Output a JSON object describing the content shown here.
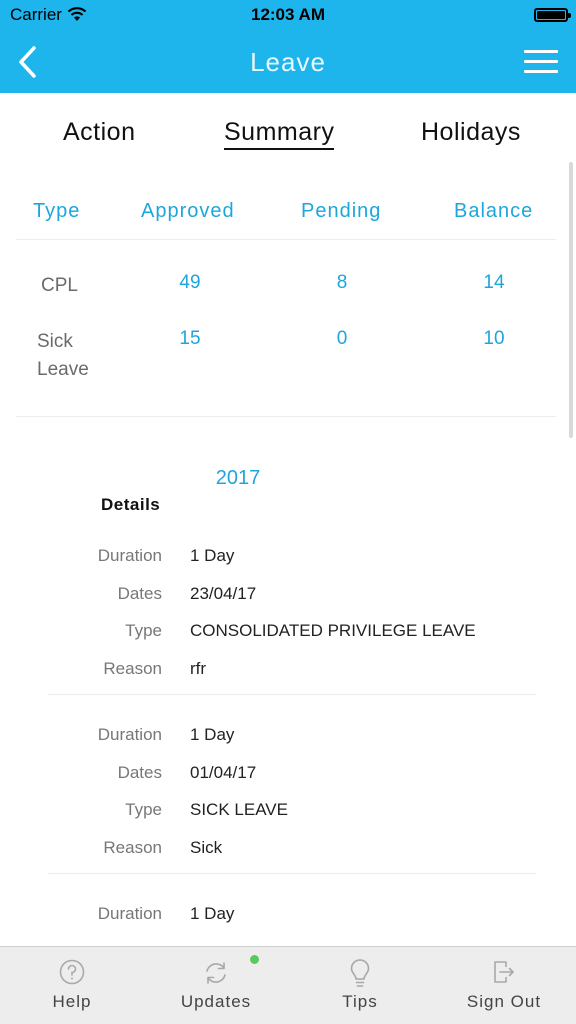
{
  "status_bar": {
    "carrier": "Carrier",
    "time": "12:03 AM"
  },
  "nav": {
    "title": "Leave"
  },
  "tabs": [
    {
      "label": "Action"
    },
    {
      "label": "Summary"
    },
    {
      "label": "Holidays"
    }
  ],
  "summary": {
    "headers": [
      "Type",
      "Approved",
      "Pending",
      "Balance"
    ],
    "rows": [
      {
        "type": "CPL",
        "approved": "49",
        "pending": "8",
        "balance": "14"
      },
      {
        "type": "Sick Leave",
        "approved": "15",
        "pending": "0",
        "balance": "10"
      }
    ]
  },
  "year": "2017",
  "details": {
    "title": "Details",
    "labels": {
      "duration": "Duration",
      "dates": "Dates",
      "type": "Type",
      "reason": "Reason"
    },
    "records": [
      {
        "duration": "1 Day",
        "dates": "23/04/17",
        "type": "CONSOLIDATED PRIVILEGE LEAVE",
        "reason": "rfr"
      },
      {
        "duration": "1 Day",
        "dates": "01/04/17",
        "type": "SICK LEAVE",
        "reason": "Sick"
      },
      {
        "duration": "1 Day"
      }
    ]
  },
  "tabbar": [
    {
      "label": "Help",
      "icon": "help-icon"
    },
    {
      "label": "Updates",
      "icon": "refresh-icon"
    },
    {
      "label": "Tips",
      "icon": "lightbulb-icon"
    },
    {
      "label": "Sign Out",
      "icon": "sign-out-icon"
    }
  ],
  "colors": {
    "accent": "#1eb4ec",
    "value_blue": "#1ea6dc",
    "tabbar_bg": "#ededed",
    "badge_green": "#5ac85a"
  }
}
